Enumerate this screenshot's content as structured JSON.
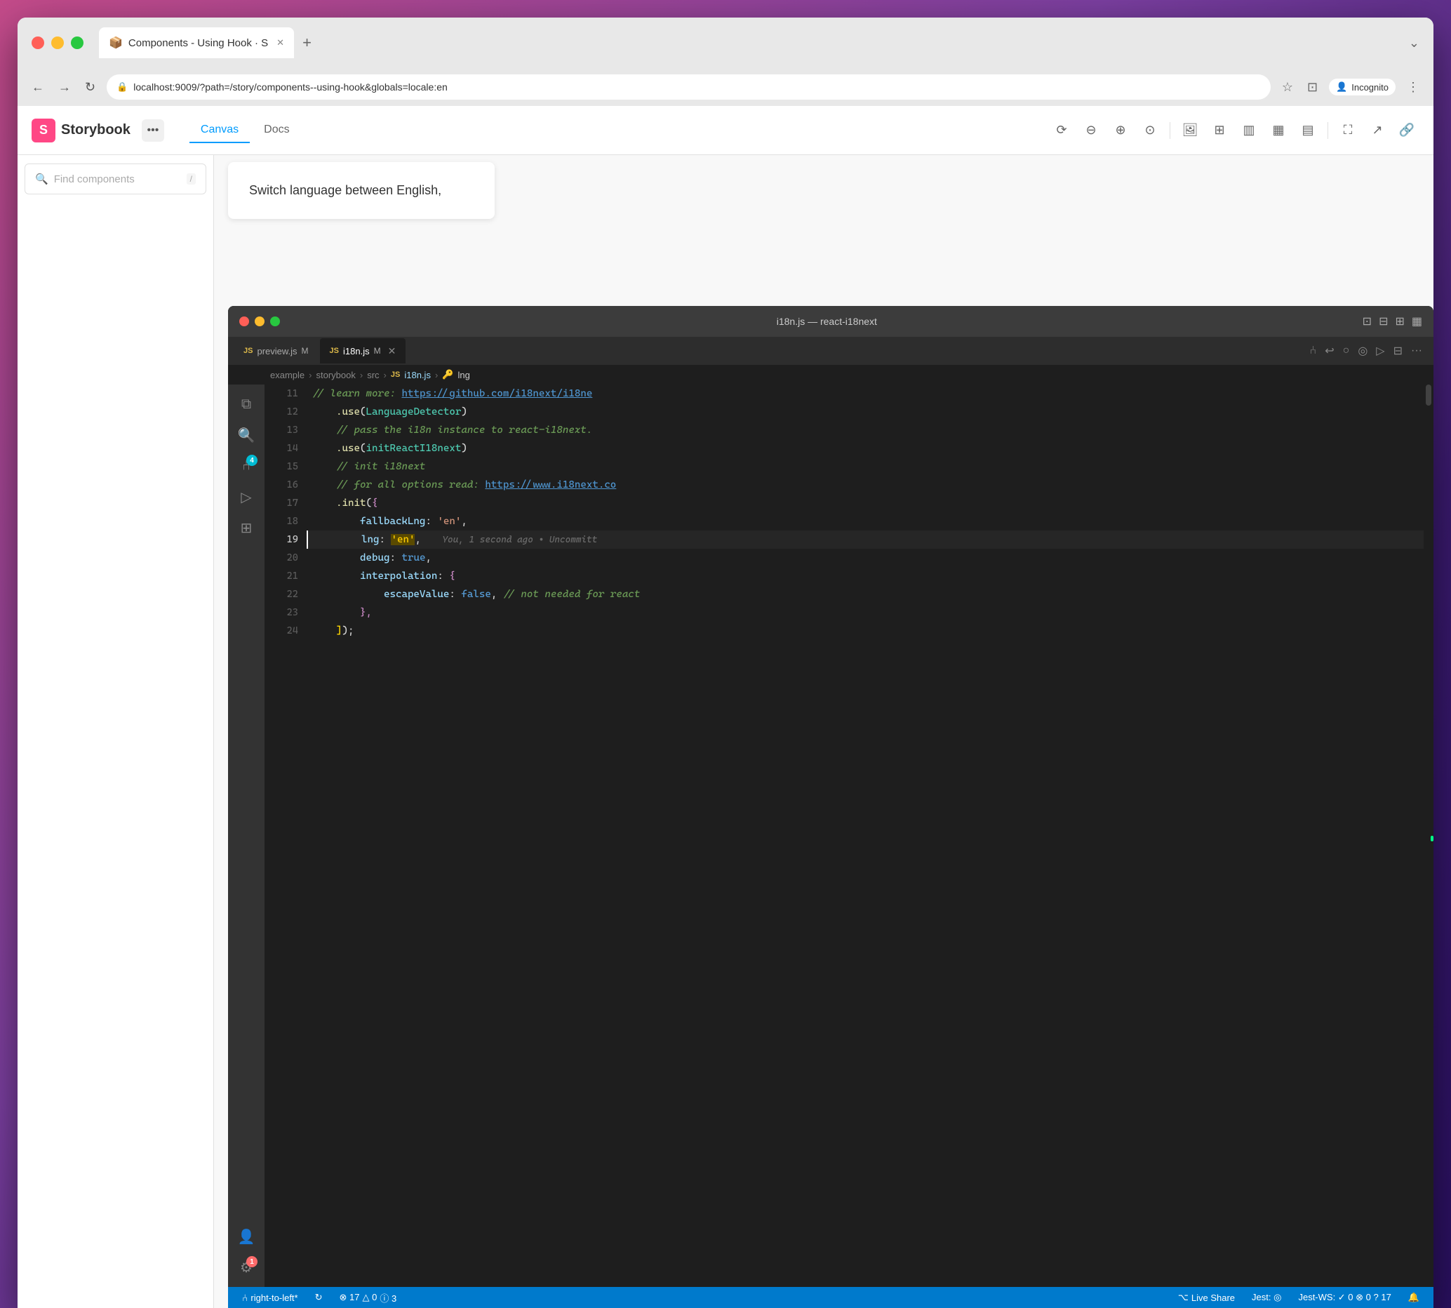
{
  "window": {
    "title": "Components - Using Hook · S",
    "url": "localhost:9009/?path=/story/components--using-hook&globals=locale:en"
  },
  "browser": {
    "tab_label": "Components - Using Hook · S",
    "new_tab_label": "+",
    "incognito_label": "Incognito",
    "nav_back": "←",
    "nav_forward": "→",
    "nav_refresh": "↻"
  },
  "storybook": {
    "title": "Storybook",
    "search_placeholder": "Find components",
    "search_shortcut": "/",
    "tabs": [
      {
        "label": "Canvas",
        "active": true
      },
      {
        "label": "Docs",
        "active": false
      }
    ],
    "canvas_preview_text": "Switch language between English,",
    "toolbar_icons": [
      "sync",
      "zoom-out",
      "zoom-in",
      "zoom-reset",
      "image",
      "grid",
      "layout",
      "layout2",
      "layout3",
      "fullscreen",
      "open-external",
      "link"
    ]
  },
  "vscode": {
    "title": "i18n.js — react-i18next",
    "tabs": [
      {
        "label": "preview.js",
        "badge": "JS",
        "modified": "M",
        "active": false
      },
      {
        "label": "i18n.js",
        "badge": "JS",
        "modified": "M",
        "active": true,
        "closeable": true
      }
    ],
    "breadcrumb": [
      "example",
      "storybook",
      "src",
      "i18n.js",
      "lng"
    ],
    "lines": [
      {
        "num": 11,
        "tokens": [
          {
            "t": "comment",
            "v": "// learn more: "
          },
          {
            "t": "url",
            "v": "https://github.com/i18next/i18ne"
          }
        ]
      },
      {
        "num": 12,
        "tokens": [
          {
            "t": "plain",
            "v": "    "
          },
          {
            "t": "method",
            "v": ".use"
          },
          {
            "t": "paren",
            "v": "("
          },
          {
            "t": "class",
            "v": "LanguageDetector"
          },
          {
            "t": "paren",
            "v": ")"
          }
        ]
      },
      {
        "num": 13,
        "tokens": [
          {
            "t": "comment",
            "v": "    // pass the i18n instance to react-i18next."
          }
        ]
      },
      {
        "num": 14,
        "tokens": [
          {
            "t": "plain",
            "v": "    "
          },
          {
            "t": "method",
            "v": ".use"
          },
          {
            "t": "paren",
            "v": "("
          },
          {
            "t": "class",
            "v": "initReactI18next"
          },
          {
            "t": "paren",
            "v": ")"
          }
        ]
      },
      {
        "num": 15,
        "tokens": [
          {
            "t": "comment",
            "v": "    // init i18next"
          }
        ]
      },
      {
        "num": 16,
        "tokens": [
          {
            "t": "comment",
            "v": "    // for all options read: "
          },
          {
            "t": "url",
            "v": "https://www.i18next.co"
          }
        ]
      },
      {
        "num": 17,
        "tokens": [
          {
            "t": "plain",
            "v": "    "
          },
          {
            "t": "method",
            "v": ".init"
          },
          {
            "t": "paren",
            "v": "("
          },
          {
            "t": "curly",
            "v": "{"
          }
        ]
      },
      {
        "num": 18,
        "tokens": [
          {
            "t": "plain",
            "v": "        "
          },
          {
            "t": "key",
            "v": "fallbackLng"
          },
          {
            "t": "punct",
            "v": ": "
          },
          {
            "t": "string",
            "v": "'en'"
          },
          {
            "t": "punct",
            "v": ","
          }
        ]
      },
      {
        "num": 19,
        "tokens": [
          {
            "t": "plain",
            "v": "        "
          },
          {
            "t": "key",
            "v": "lng"
          },
          {
            "t": "punct",
            "v": ": "
          },
          {
            "t": "highlight",
            "v": "'en'"
          },
          {
            "t": "punct",
            "v": ","
          },
          {
            "t": "hint",
            "v": "    You, 1 second ago • Uncommitt"
          }
        ],
        "active": true
      },
      {
        "num": 20,
        "tokens": [
          {
            "t": "plain",
            "v": "        "
          },
          {
            "t": "key",
            "v": "debug"
          },
          {
            "t": "punct",
            "v": ": "
          },
          {
            "t": "bool",
            "v": "true"
          },
          {
            "t": "punct",
            "v": ","
          }
        ]
      },
      {
        "num": 21,
        "tokens": [
          {
            "t": "plain",
            "v": "        "
          },
          {
            "t": "key",
            "v": "interpolation"
          },
          {
            "t": "punct",
            "v": ": "
          },
          {
            "t": "curly",
            "v": "{"
          }
        ]
      },
      {
        "num": 22,
        "tokens": [
          {
            "t": "plain",
            "v": "            "
          },
          {
            "t": "key",
            "v": "escapeValue"
          },
          {
            "t": "punct",
            "v": ": "
          },
          {
            "t": "bool",
            "v": "false"
          },
          {
            "t": "punct",
            "v": ","
          },
          {
            "t": "comment",
            "v": " // not needed for react"
          }
        ]
      },
      {
        "num": 23,
        "tokens": [
          {
            "t": "plain",
            "v": "        "
          },
          {
            "t": "curly",
            "v": "},"
          },
          {
            "t": "punct",
            "v": ""
          }
        ]
      },
      {
        "num": 24,
        "tokens": [
          {
            "t": "plain",
            "v": "    "
          },
          {
            "t": "bracket",
            "v": "]"
          },
          {
            "t": "punct",
            "v": ");"
          }
        ]
      }
    ],
    "statusbar": {
      "branch": "right-to-left*",
      "sync": "↻",
      "errors": "⊗ 17",
      "warnings": "△ 0",
      "info": "ⓘ 3",
      "live_share": "⌥ Live Share",
      "jest": "Jest: ◎",
      "jest_ws": "Jest-WS: ✓ 0 ⊗ 0 ? 17"
    }
  }
}
